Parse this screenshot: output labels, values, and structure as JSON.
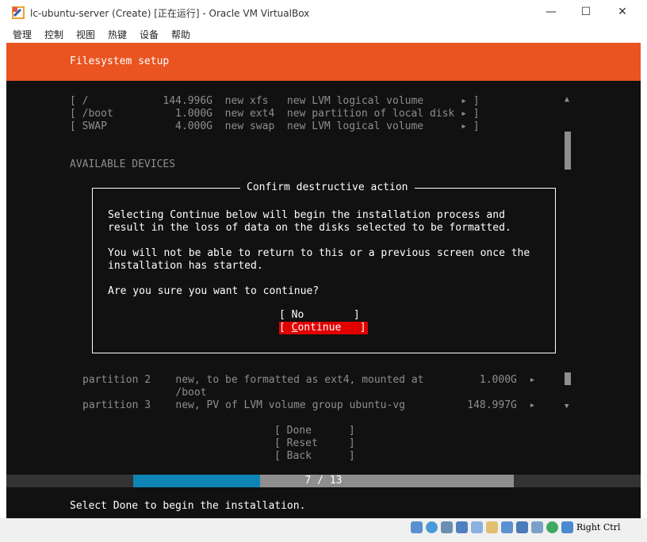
{
  "window": {
    "title": "lc-ubuntu-server (Create) [正在运行] - Oracle VM VirtualBox",
    "minimize_glyph": "—",
    "maximize_glyph": "☐",
    "close_glyph": "✕"
  },
  "menu": {
    "items": [
      "管理",
      "控制",
      "视图",
      "热键",
      "设备",
      "帮助"
    ]
  },
  "installer": {
    "header_title": "Filesystem setup",
    "fs_rows": [
      "[ /            144.996G  new xfs   new LVM logical volume      ▸ ]",
      "[ /boot          1.000G  new ext4  new partition of local disk ▸ ]",
      "[ SWAP           4.000G  new swap  new LVM logical volume      ▸ ]"
    ],
    "available_devices_label": "AVAILABLE DEVICES",
    "partitions": [
      {
        "line1": "partition 2    new, to be formatted as ext4, mounted at         1.000G  ▸",
        "line2": "               /boot"
      },
      {
        "line1": "partition 3    new, PV of LVM volume group ubuntu-vg          148.997G  ▸"
      }
    ],
    "action_buttons": [
      "[ Done      ]",
      "[ Reset     ]",
      "[ Back      ]"
    ],
    "progress_text": "7 / 13",
    "progress_fraction": 0.333,
    "footer_text": "Select Done to begin the installation."
  },
  "dialog": {
    "title": "Confirm destructive action",
    "para1_line1": "Selecting Continue below will begin the installation process and",
    "para1_line2": "result in the loss of data on the disks selected to be formatted.",
    "para2_line1": "You will not be able to return to this or a previous screen once the",
    "para2_line2": "installation has started.",
    "question": "Are you sure you want to continue?",
    "no_button": "[ No        ]",
    "continue_open": "[ ",
    "continue_first": "C",
    "continue_rest": "ontinue   ]"
  },
  "statusbar": {
    "host_key": "Right Ctrl",
    "icons": [
      "hard-disk-icon",
      "optical-disk-icon",
      "audio-icon",
      "network-icon",
      "usb-icon",
      "shared-folder-icon",
      "display-icon",
      "recording-icon",
      "cpu-icon",
      "arrow-icon",
      "mouse-integration-icon"
    ]
  },
  "colors": {
    "header_orange": "#e95420",
    "continue_red": "#e00000",
    "progress_blue": "#0e84b5",
    "terminal_bg": "#111111"
  }
}
